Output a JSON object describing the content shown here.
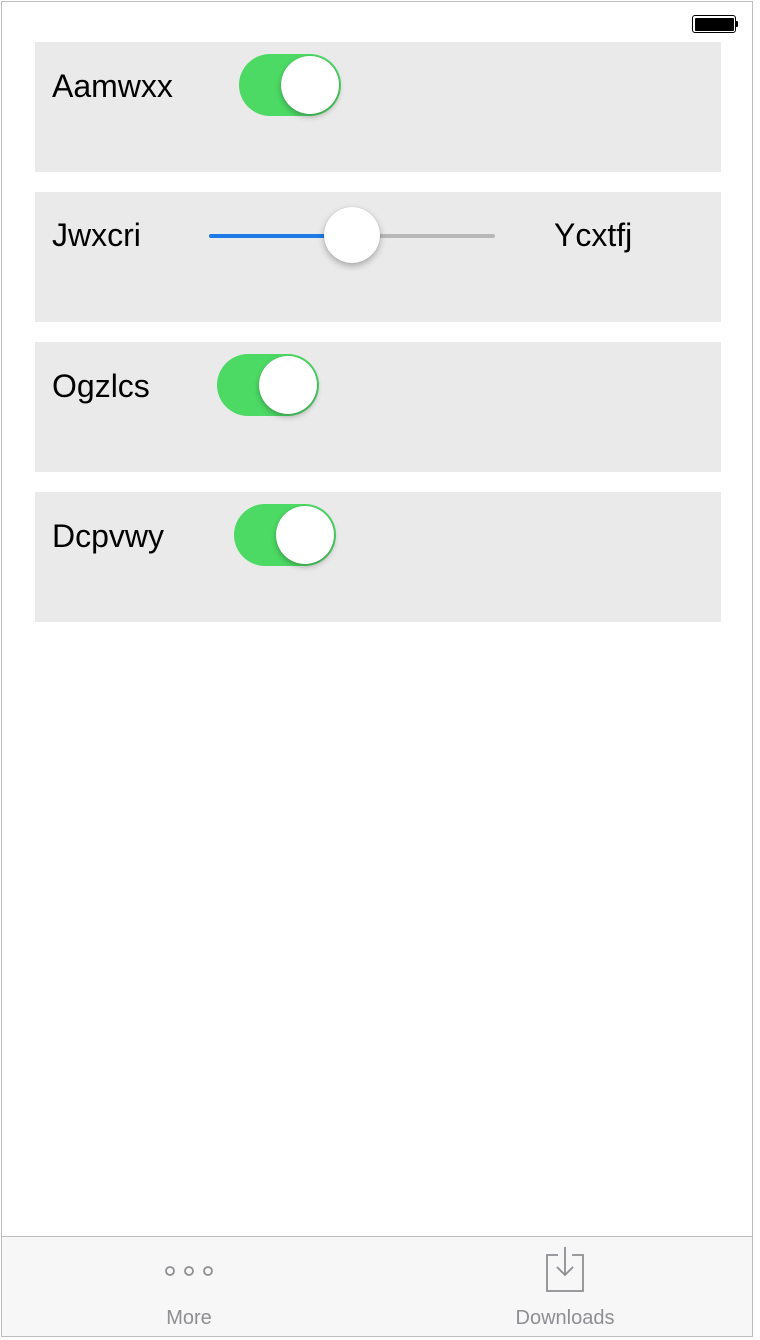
{
  "status_bar": {
    "battery_icon": "battery-full-icon"
  },
  "settings": [
    {
      "type": "toggle",
      "label": "Aamwxx",
      "on": true
    },
    {
      "type": "slider",
      "label": "Jwxcri",
      "end_label": "Ycxtfj",
      "value": 0.5
    },
    {
      "type": "toggle",
      "label": "Ogzlcs",
      "on": true
    },
    {
      "type": "toggle",
      "label": "Dcpvwy",
      "on": true
    }
  ],
  "tab_bar": {
    "more": {
      "label": "More",
      "icon": "more-icon"
    },
    "downloads": {
      "label": "Downloads",
      "icon": "download-icon"
    }
  },
  "colors": {
    "toggle_on": "#4cd964",
    "slider_fill": "#1e7ae6",
    "slider_track": "#b8b8b8",
    "card_background": "#eaeaea",
    "tab_label": "#8e8e93"
  }
}
